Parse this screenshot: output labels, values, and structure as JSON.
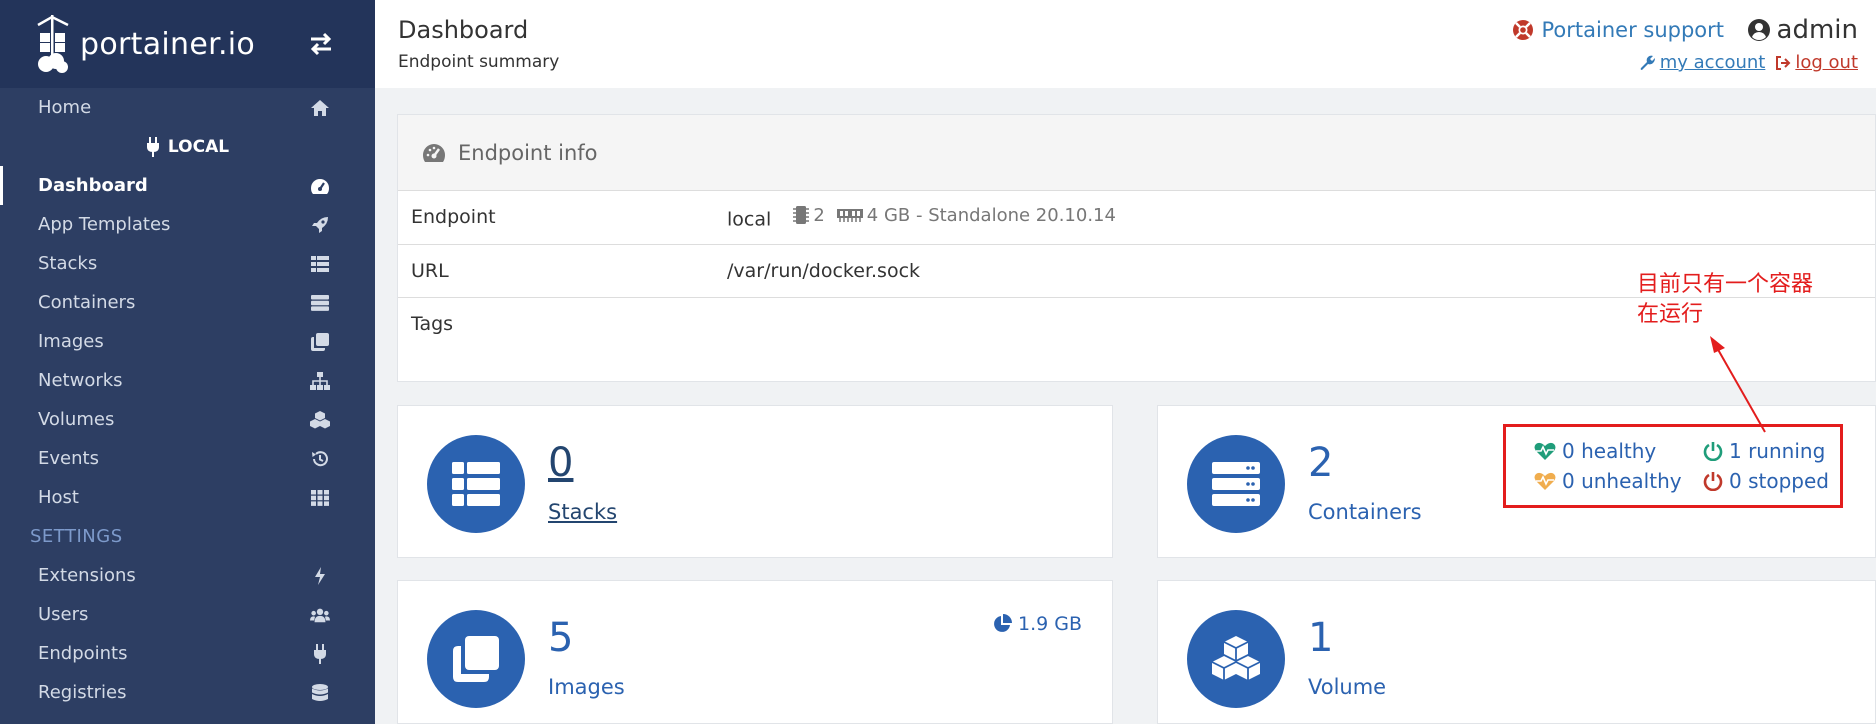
{
  "brand": {
    "name": "portainer.io"
  },
  "sidebar": {
    "home": "Home",
    "endpoint": "LOCAL",
    "items": [
      {
        "label": "Dashboard",
        "icon": "tachometer-icon"
      },
      {
        "label": "App Templates",
        "icon": "rocket-icon"
      },
      {
        "label": "Stacks",
        "icon": "th-list-icon"
      },
      {
        "label": "Containers",
        "icon": "server-icon"
      },
      {
        "label": "Images",
        "icon": "clone-icon"
      },
      {
        "label": "Networks",
        "icon": "sitemap-icon"
      },
      {
        "label": "Volumes",
        "icon": "cubes-icon"
      },
      {
        "label": "Events",
        "icon": "history-icon"
      },
      {
        "label": "Host",
        "icon": "th-icon"
      }
    ],
    "settings_title": "SETTINGS",
    "settings": [
      {
        "label": "Extensions",
        "icon": "bolt-icon"
      },
      {
        "label": "Users",
        "icon": "users-icon"
      },
      {
        "label": "Endpoints",
        "icon": "plug-icon"
      },
      {
        "label": "Registries",
        "icon": "database-icon"
      }
    ]
  },
  "header": {
    "title": "Dashboard",
    "subtitle": "Endpoint summary",
    "support": "Portainer support",
    "user": "admin",
    "my_account": "my account",
    "log_out": "log out"
  },
  "endpoint_info": {
    "title": "Endpoint info",
    "rows": [
      {
        "key": "Endpoint",
        "value": "local",
        "cpu": "2",
        "memory": "4 GB - Standalone 20.10.14"
      },
      {
        "key": "URL",
        "value": "/var/run/docker.sock"
      },
      {
        "key": "Tags",
        "value": ""
      }
    ]
  },
  "widgets": {
    "stacks": {
      "count": "0",
      "label": "Stacks"
    },
    "containers": {
      "count": "2",
      "label": "Containers"
    },
    "images": {
      "count": "5",
      "label": "Images",
      "size": "1.9 GB"
    },
    "volumes": {
      "count": "1",
      "label": "Volume"
    }
  },
  "container_stats": {
    "healthy": "0 healthy",
    "unhealthy": "0 unhealthy",
    "running": "1 running",
    "stopped": "0 stopped"
  },
  "annotation": {
    "line1": "目前只有一个容器",
    "line2": "在运行"
  },
  "colors": {
    "sidebar": "#2d3e63",
    "brand_bg": "#23345a",
    "primary": "#2b62b0",
    "healthy": "#1f9d7a",
    "unhealthy": "#f0ad4e",
    "running": "#1f9d7a",
    "stopped": "#c0392b",
    "annotation": "#e31d1d"
  }
}
